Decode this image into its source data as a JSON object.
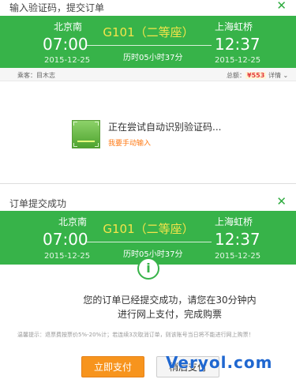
{
  "panel1": {
    "title": "输入验证码，提交订单",
    "close": "✕",
    "from_station": "北京南",
    "to_station": "上海虹桥",
    "dep_time": "07:00",
    "arr_time": "12:37",
    "dep_date": "2015-12-25",
    "arr_date": "2015-12-25",
    "train": "G101（二等座）",
    "duration": "历时05小时37分",
    "passenger_label": "乘客：目木志",
    "total_label": "总额：",
    "total_price": "¥553",
    "details_label": "详情",
    "details_arrow": "⌄",
    "recognizing": "正在尝试自动识别验证码...",
    "manual_link": "我要手动输入"
  },
  "panel2": {
    "title": "订单提交成功",
    "close": "✕",
    "from_station": "北京南",
    "to_station": "上海虹桥",
    "dep_time": "07:00",
    "arr_time": "12:37",
    "dep_date": "2015-12-25",
    "arr_date": "2015-12-25",
    "train": "G101（二等座）",
    "duration": "历时05小时37分",
    "info_glyph": "i",
    "message_line1": "您的订单已经提交成功，请您在30分钟内",
    "message_line2": "进行网上支付，完成购票",
    "tip": "温馨提示：退票费按票价5%-20%计；若连续3次取消订单，则该账号当日将不能进行网上购票！",
    "pay_button": "立即支付",
    "later_button": "稍后支付"
  },
  "watermark": "Veryol.com",
  "colors": {
    "green": "#37b349",
    "train_yellow": "#f5e44a",
    "pay_orange": "#f7941d",
    "price_red": "#e4393c",
    "watermark_blue": "#1f67d0"
  }
}
